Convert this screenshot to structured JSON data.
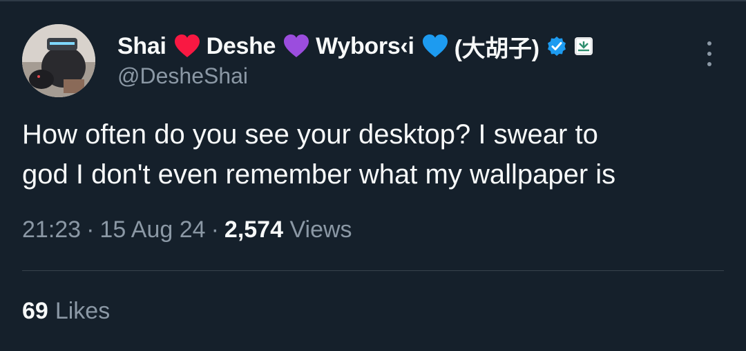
{
  "tweet": {
    "author": {
      "name_parts": [
        "Shai",
        "Deshe",
        "Wybors‹i",
        "(大胡子)"
      ],
      "heart_colors": [
        "#f91842",
        "#9b4dde",
        "#1d9bf0"
      ],
      "handle": "@DesheShai",
      "verified_badge": "verified-badge-icon",
      "affiliate_badge": "affiliate-badge-icon",
      "accent_color": "#1d9bf0"
    },
    "text_line1": "How often do you see your desktop? I swear to",
    "text_line2": "god I don't even remember what my wallpaper is",
    "time": "21:23",
    "date": "15 Aug 24",
    "separator": "·",
    "views_count": "2,574",
    "views_label": "Views",
    "likes_count": "69",
    "likes_label": "Likes",
    "more_icon": "more-vertical-icon"
  }
}
